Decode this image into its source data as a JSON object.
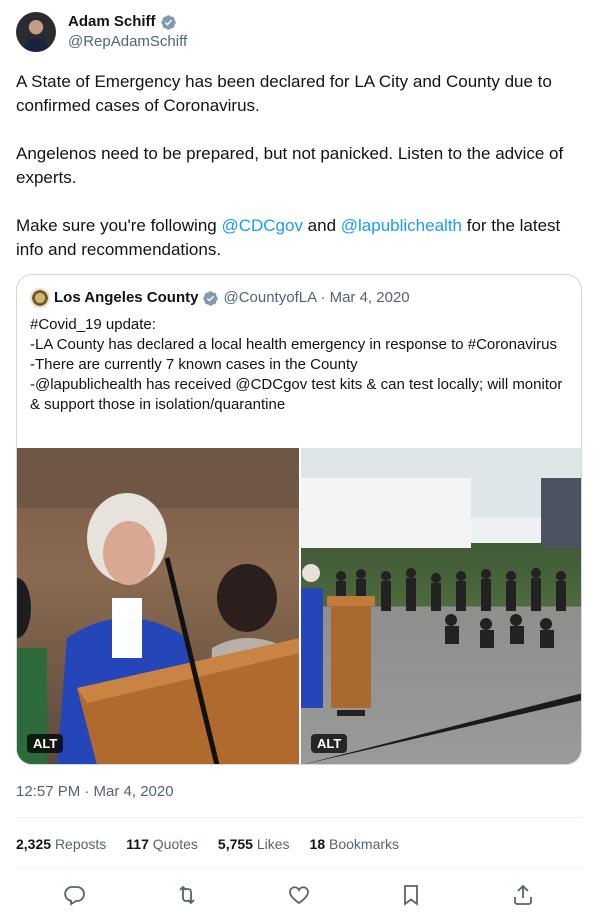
{
  "tweet": {
    "author_name": "Adam Schiff",
    "author_handle": "@RepAdamSchiff",
    "paragraph_1": "A State of Emergency has been declared for LA City and County due to confirmed cases of Coronavirus.",
    "paragraph_2": "Angelenos need to be prepared, but not panicked. Listen to the advice of experts.",
    "paragraph_3_prefix": "Make sure you're following ",
    "mention_1": "@CDCgov",
    "paragraph_3_middle": " and ",
    "mention_2": "@lapublichealth",
    "paragraph_3_suffix": " for the latest info and recommendations.",
    "timestamp": "12:57 PM · Mar 4, 2020"
  },
  "quoted": {
    "name": "Los Angeles County",
    "handle_date": "@CountyofLA · Mar 4, 2020",
    "text": "#Covid_19 update:\n-LA County has declared a local health emergency in response to #Coronavirus\n-There are currently 7 known cases in the County\n-@lapublichealth has received @CDCgov test kits & can test locally; will monitor & support those in isolation/quarantine",
    "alt_badge_1": "ALT",
    "alt_badge_2": "ALT"
  },
  "stats": {
    "reposts_count": "2,325",
    "reposts_label": "Reposts",
    "quotes_count": "117",
    "quotes_label": "Quotes",
    "likes_count": "5,755",
    "likes_label": "Likes",
    "bookmarks_count": "18",
    "bookmarks_label": "Bookmarks"
  },
  "colors": {
    "link": "#1d9bf0",
    "secondary_text": "#536471",
    "border": "#cfd9de"
  },
  "icons": [
    "verified-badge-icon",
    "reply-icon",
    "repost-icon",
    "like-icon",
    "bookmark-icon",
    "share-icon"
  ]
}
